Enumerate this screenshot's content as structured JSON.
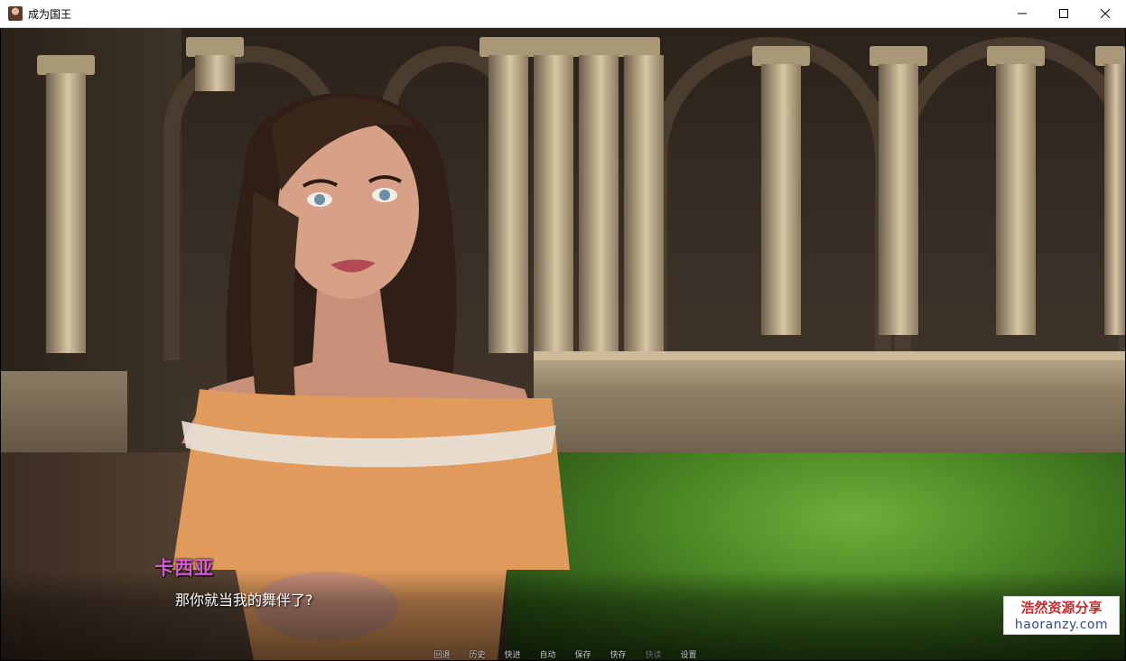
{
  "window": {
    "title": "成为国王",
    "icon": "app-portrait-icon",
    "controls": [
      "minimize-icon",
      "maximize-icon",
      "close-icon"
    ]
  },
  "dialogue": {
    "speaker": "卡西亚",
    "speaker_color": "#d25bd2",
    "text": "那你就当我的舞伴了?"
  },
  "quick_menu": [
    {
      "label": "回退",
      "enabled": true
    },
    {
      "label": "历史",
      "enabled": true
    },
    {
      "label": "快进",
      "enabled": true
    },
    {
      "label": "自动",
      "enabled": true
    },
    {
      "label": "保存",
      "enabled": true
    },
    {
      "label": "快存",
      "enabled": true
    },
    {
      "label": "快读",
      "enabled": false
    },
    {
      "label": "设置",
      "enabled": true
    }
  ],
  "watermark": {
    "line1": "浩然资源分享",
    "line2": "haoranzy.com"
  }
}
